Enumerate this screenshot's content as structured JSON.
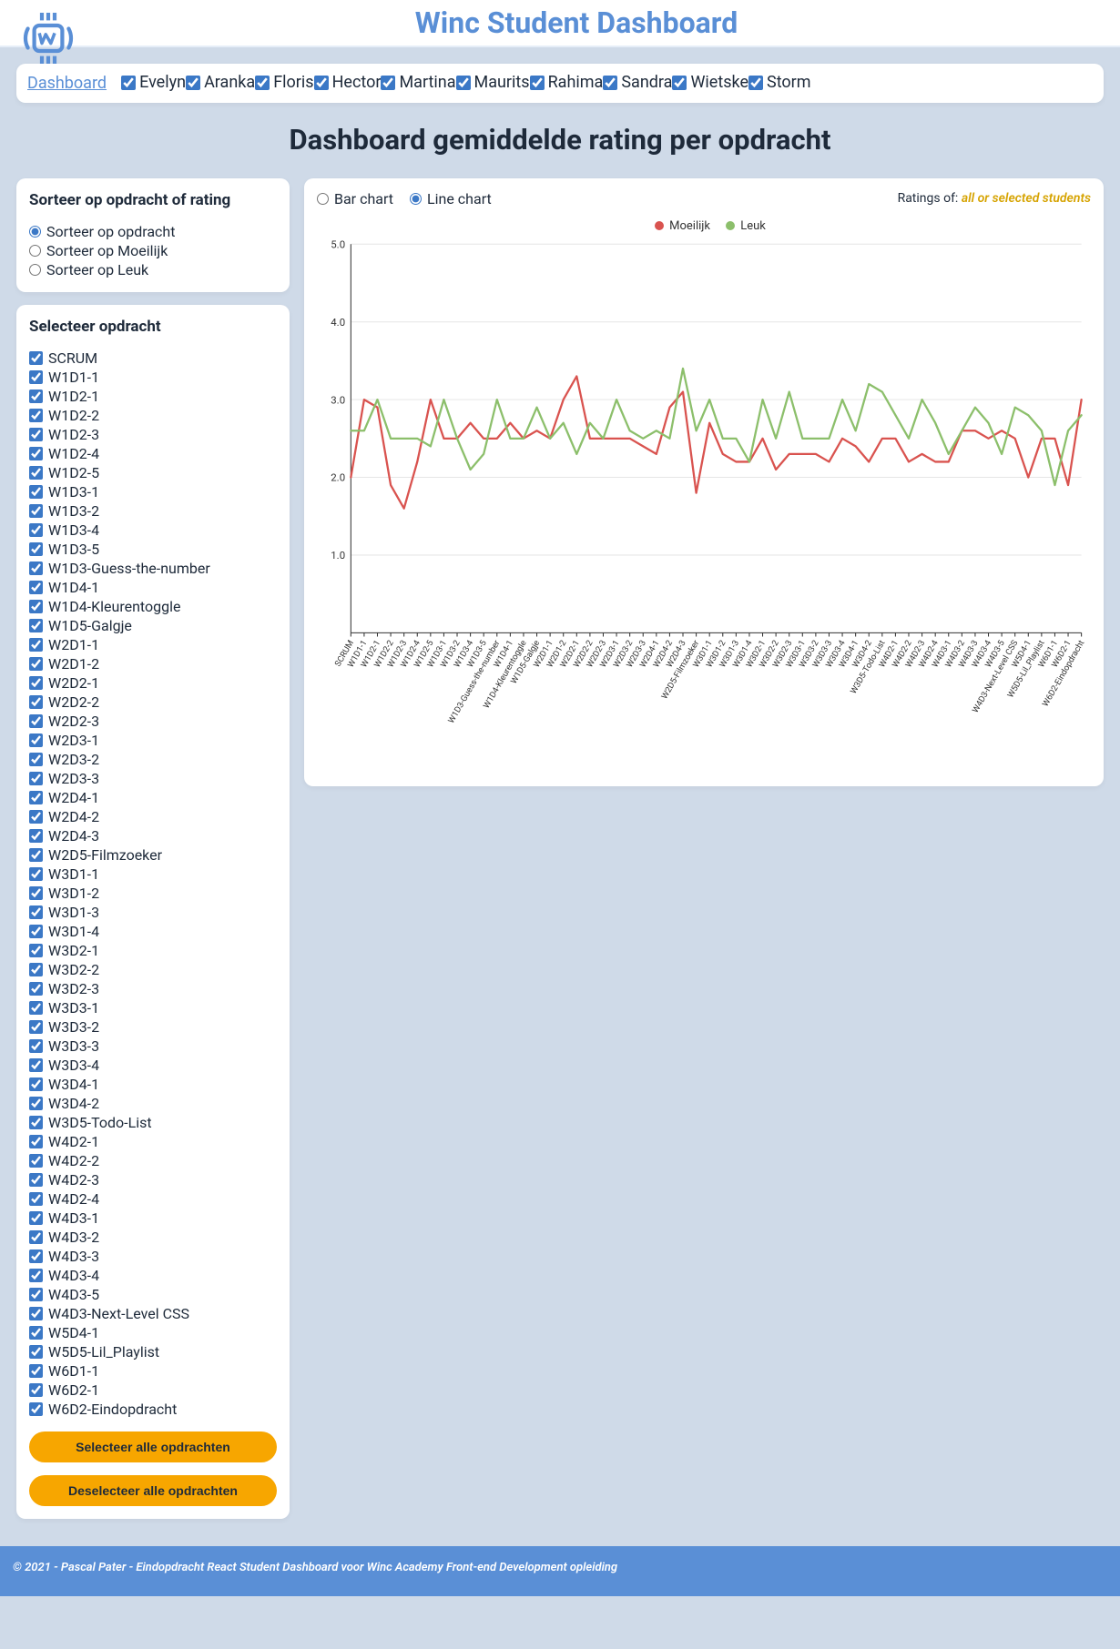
{
  "header": {
    "app_title": "Winc Student Dashboard"
  },
  "nav": {
    "dashboard": "Dashboard",
    "students": [
      "Evelyn",
      "Aranka",
      "Floris",
      "Hector",
      "Martina",
      "Maurits",
      "Rahima",
      "Sandra",
      "Wietske",
      "Storm"
    ]
  },
  "page_title": "Dashboard gemiddelde rating per opdracht",
  "sort_panel": {
    "heading": "Sorteer op opdracht of rating",
    "options": [
      "Sorteer op opdracht",
      "Sorteer op Moeilijk",
      "Sorteer op Leuk"
    ],
    "selected": 0
  },
  "assign_panel": {
    "heading": "Selecteer opdracht",
    "items": [
      "SCRUM",
      "W1D1-1",
      "W1D2-1",
      "W1D2-2",
      "W1D2-3",
      "W1D2-4",
      "W1D2-5",
      "W1D3-1",
      "W1D3-2",
      "W1D3-4",
      "W1D3-5",
      "W1D3-Guess-the-number",
      "W1D4-1",
      "W1D4-Kleurentoggle",
      "W1D5-Galgje",
      "W2D1-1",
      "W2D1-2",
      "W2D2-1",
      "W2D2-2",
      "W2D2-3",
      "W2D3-1",
      "W2D3-2",
      "W2D3-3",
      "W2D4-1",
      "W2D4-2",
      "W2D4-3",
      "W2D5-Filmzoeker",
      "W3D1-1",
      "W3D1-2",
      "W3D1-3",
      "W3D1-4",
      "W3D2-1",
      "W3D2-2",
      "W3D2-3",
      "W3D3-1",
      "W3D3-2",
      "W3D3-3",
      "W3D3-4",
      "W3D4-1",
      "W3D4-2",
      "W3D5-Todo-List",
      "W4D2-1",
      "W4D2-2",
      "W4D2-3",
      "W4D2-4",
      "W4D3-1",
      "W4D3-2",
      "W4D3-3",
      "W4D3-4",
      "W4D3-5",
      "W4D3-Next-Level CSS",
      "W5D4-1",
      "W5D5-Lil_Playlist",
      "W6D1-1",
      "W6D2-1",
      "W6D2-Eindopdracht"
    ],
    "select_all": "Selecteer alle opdrachten",
    "deselect_all": "Deselecteer alle opdrachten"
  },
  "chart_panel": {
    "types": [
      "Bar chart",
      "Line chart"
    ],
    "selected_type": 1,
    "ratings_of_label": "Ratings of:",
    "ratings_of_value": "all or selected students"
  },
  "legend": {
    "moeilijk": {
      "label": "Moeilijk",
      "color": "#d9534f"
    },
    "leuk": {
      "label": "Leuk",
      "color": "#8cbf6b"
    }
  },
  "chart_data": {
    "type": "line",
    "title": "",
    "xlabel": "",
    "ylabel": "",
    "ylim": [
      0,
      5
    ],
    "yticks": [
      1.0,
      2.0,
      3.0,
      4.0,
      5.0
    ],
    "categories": [
      "SCRUM",
      "W1D1-1",
      "W1D2-1",
      "W1D2-2",
      "W1D2-3",
      "W1D2-4",
      "W1D2-5",
      "W1D3-1",
      "W1D3-2",
      "W1D3-4",
      "W1D3-5",
      "W1D3-Guess-the-number",
      "W1D4-1",
      "W1D4-Kleurentoggle",
      "W1D5-Galgje",
      "W2D1-1",
      "W2D1-2",
      "W2D2-1",
      "W2D2-2",
      "W2D2-3",
      "W2D3-1",
      "W2D3-2",
      "W2D3-3",
      "W2D4-1",
      "W2D4-2",
      "W2D4-3",
      "W2D5-Filmzoeker",
      "W3D1-1",
      "W3D1-2",
      "W3D1-3",
      "W3D1-4",
      "W3D2-1",
      "W3D2-2",
      "W3D2-3",
      "W3D3-1",
      "W3D3-2",
      "W3D3-3",
      "W3D3-4",
      "W3D4-1",
      "W3D4-2",
      "W3D5-Todo-List",
      "W4D2-1",
      "W4D2-2",
      "W4D2-3",
      "W4D2-4",
      "W4D3-1",
      "W4D3-2",
      "W4D3-3",
      "W4D3-4",
      "W4D3-5",
      "W4D3-Next-Level CSS",
      "W5D4-1",
      "W5D5-Lil_Playlist",
      "W6D1-1",
      "W6D2-1",
      "W6D2-Eindopdracht"
    ],
    "series": [
      {
        "name": "Moeilijk",
        "color": "#d9534f",
        "values": [
          2.0,
          3.0,
          2.9,
          1.9,
          1.6,
          2.2,
          3.0,
          2.5,
          2.5,
          2.7,
          2.5,
          2.5,
          2.7,
          2.5,
          2.6,
          2.5,
          3.0,
          3.3,
          2.5,
          2.5,
          2.5,
          2.5,
          2.4,
          2.3,
          2.9,
          3.1,
          1.8,
          2.7,
          2.3,
          2.2,
          2.2,
          2.5,
          2.1,
          2.3,
          2.3,
          2.3,
          2.2,
          2.5,
          2.4,
          2.2,
          2.5,
          2.5,
          2.2,
          2.3,
          2.2,
          2.2,
          2.6,
          2.6,
          2.5,
          2.6,
          2.5,
          2.0,
          2.5,
          2.5,
          1.9,
          3.0
        ]
      },
      {
        "name": "Leuk",
        "color": "#8cbf6b",
        "values": [
          2.6,
          2.6,
          3.0,
          2.5,
          2.5,
          2.5,
          2.4,
          3.0,
          2.5,
          2.1,
          2.3,
          3.0,
          2.5,
          2.5,
          2.9,
          2.5,
          2.7,
          2.3,
          2.7,
          2.5,
          3.0,
          2.6,
          2.5,
          2.6,
          2.5,
          3.4,
          2.6,
          3.0,
          2.5,
          2.5,
          2.2,
          3.0,
          2.5,
          3.1,
          2.5,
          2.5,
          2.5,
          3.0,
          2.6,
          3.2,
          3.1,
          2.8,
          2.5,
          3.0,
          2.7,
          2.3,
          2.6,
          2.9,
          2.7,
          2.3,
          2.9,
          2.8,
          2.6,
          1.9,
          2.6,
          2.8
        ]
      }
    ]
  },
  "footer": "© 2021 - Pascal Pater - Eindopdracht React Student Dashboard voor Winc Academy Front-end Development opleiding"
}
